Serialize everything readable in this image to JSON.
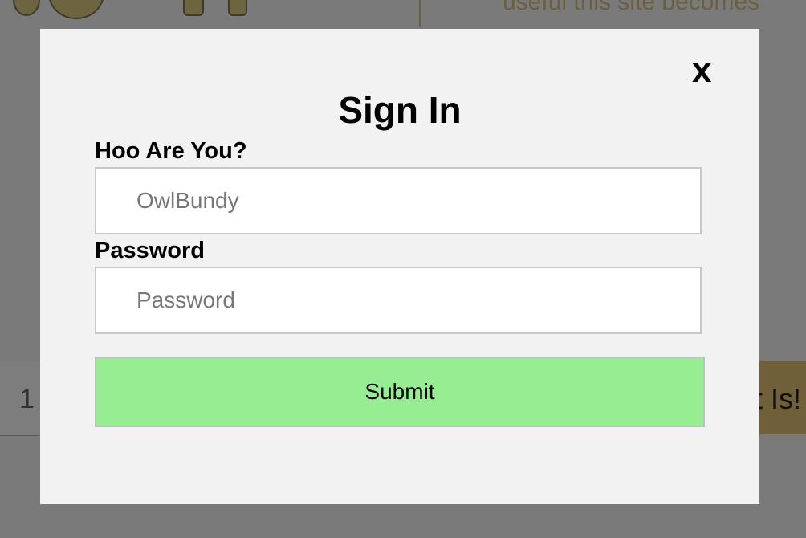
{
  "background": {
    "top_text": "useful this site becomes",
    "left_box_text": "1",
    "right_button_text": "t Is!"
  },
  "modal": {
    "title": "Sign In",
    "close_label": "x",
    "username": {
      "label": "Hoo Are You?",
      "placeholder": "OwlBundy"
    },
    "password": {
      "label": "Password",
      "placeholder": "Password"
    },
    "submit_label": "Submit"
  },
  "colors": {
    "overlay": "#7a7a7a",
    "modal_bg": "#f2f2f2",
    "submit_bg": "#97ee92"
  }
}
